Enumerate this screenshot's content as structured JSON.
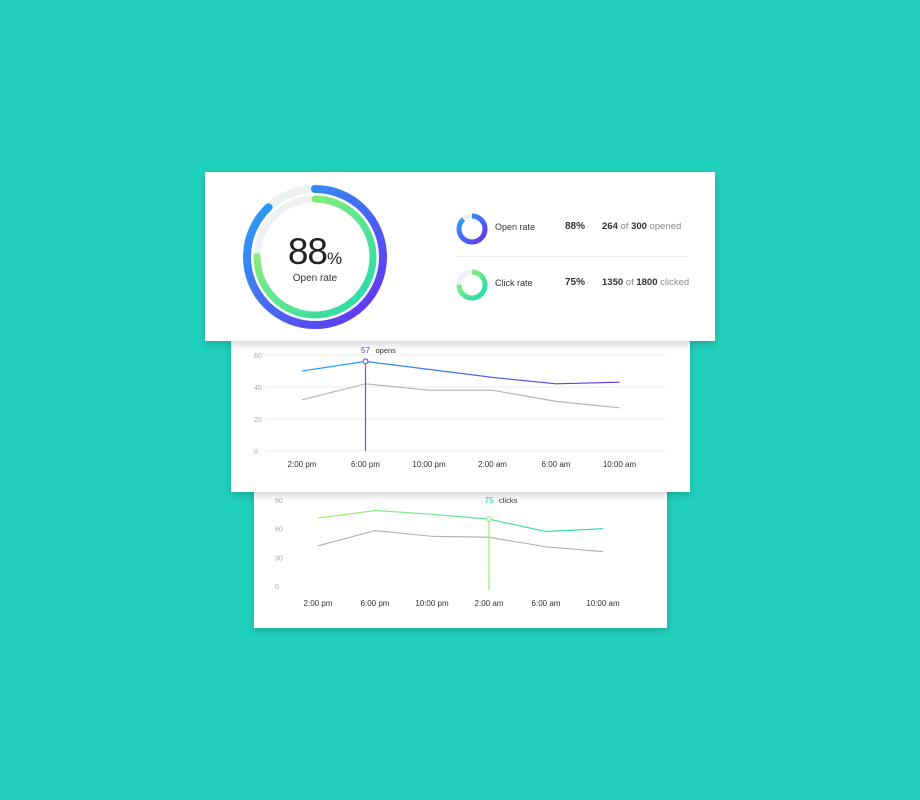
{
  "summary": {
    "percent": "88",
    "percent_sign": "%",
    "label": "Open rate",
    "ring_outer_fraction": 0.88,
    "ring_inner_fraction": 0.75,
    "colors": {
      "outer_start": "#6a2df0",
      "outer_end": "#22a8f5",
      "inner_start": "#1ed8b0",
      "inner_end": "#a6f26e",
      "track": "#eef1f2"
    },
    "rows": [
      {
        "label": "Open rate",
        "percent": "75%",
        "ignore": true
      }
    ]
  },
  "rows": [
    {
      "label": "Open rate",
      "percent": "88%",
      "fraction": 0.88,
      "count": "264",
      "of": "of",
      "total": "300",
      "suffix": "opened",
      "color_start": "#6a2df0",
      "color_end": "#22a8f5"
    },
    {
      "label": "Click rate",
      "percent": "75%",
      "fraction": 0.75,
      "count": "1350",
      "of": "of",
      "total": "1800",
      "suffix": "clicked",
      "color_start": "#1ed8b0",
      "color_end": "#a6f26e"
    }
  ],
  "chart_data": [
    {
      "type": "line",
      "x": [
        "2:00 pm",
        "6:00 pm",
        "10:00 pm",
        "2:00 am",
        "6:00 am",
        "10:00 am"
      ],
      "yticks": [
        "60",
        "40",
        "20",
        "0"
      ],
      "ylim": [
        0,
        60
      ],
      "series": [
        {
          "values": [
            50,
            56,
            51,
            46,
            42,
            43
          ],
          "color_start": "#22a8f5",
          "color_end": "#6a2df0"
        },
        {
          "values": [
            32,
            42,
            38,
            38,
            31,
            27
          ],
          "color": "#b4b4b4"
        }
      ],
      "highlight": {
        "index": 1,
        "value": "57",
        "label": "opens",
        "color": "#6a2df0",
        "line_color": "#7a4cf0"
      }
    },
    {
      "type": "line",
      "x": [
        "2:00 pm",
        "6:00 pm",
        "10:00 pm",
        "2:00 am",
        "6:00 am",
        "10:00 am"
      ],
      "yticks": [
        "90",
        "60",
        "30",
        "0"
      ],
      "ylim": [
        0,
        90
      ],
      "series": [
        {
          "values": [
            71,
            79,
            75,
            70,
            57,
            60
          ],
          "color_start": "#a6f26e",
          "color_end": "#1ed8b0"
        },
        {
          "values": [
            42,
            58,
            52,
            51,
            41,
            36
          ],
          "color": "#b4b4b4"
        }
      ],
      "highlight": {
        "index": 3,
        "value": "75",
        "label": "clicks",
        "color": "#1ed8b0",
        "line_color": "#8ef07a"
      }
    }
  ]
}
